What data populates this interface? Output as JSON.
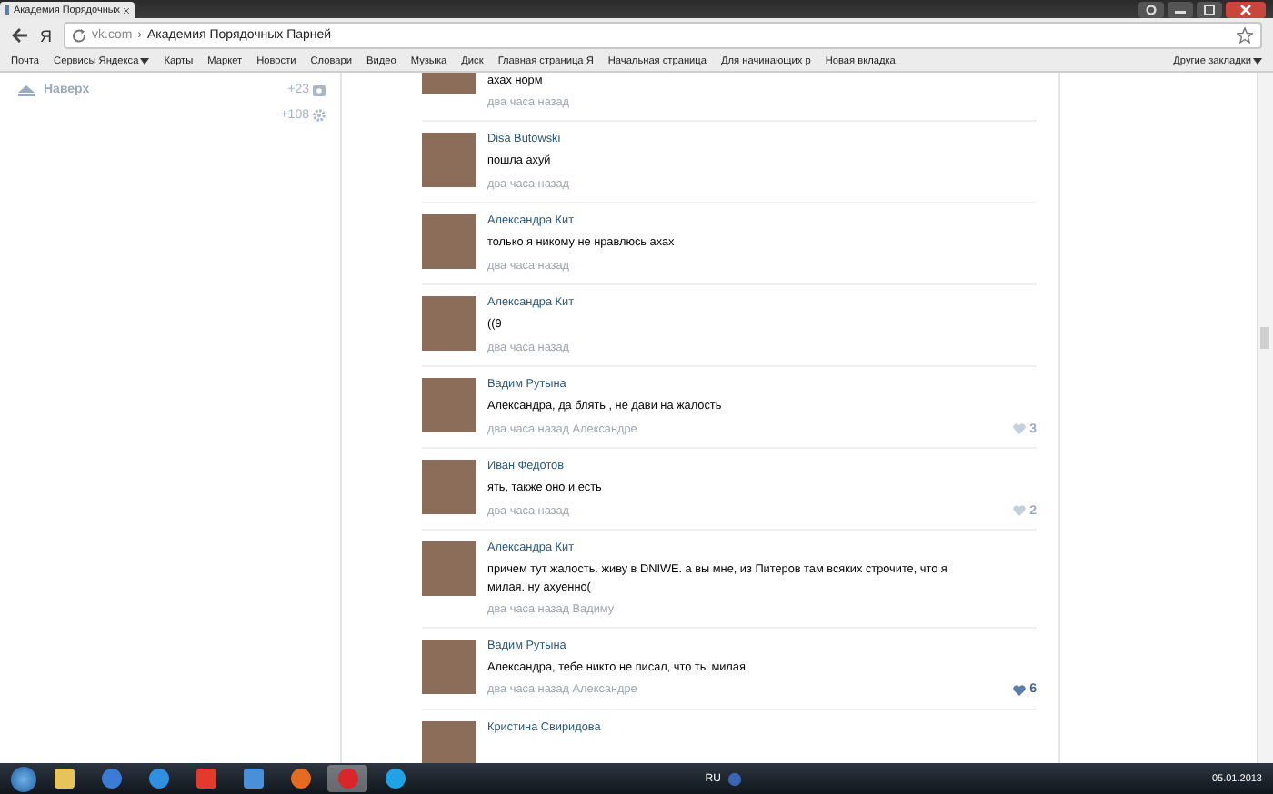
{
  "browser": {
    "tab": {
      "title": "Академия Порядочных"
    },
    "address": {
      "logo": "Я",
      "domain": "vk.com",
      "separator": "›",
      "title": "Академия Порядочных Парней"
    },
    "bookmarks": [
      {
        "label": "Почта",
        "menu": false
      },
      {
        "label": "Сервисы Яндекса",
        "menu": true
      },
      {
        "label": "Карты",
        "menu": false
      },
      {
        "label": "Маркет",
        "menu": false
      },
      {
        "label": "Новости",
        "menu": false
      },
      {
        "label": "Словари",
        "menu": false
      },
      {
        "label": "Видео",
        "menu": false
      },
      {
        "label": "Музыка",
        "menu": false
      },
      {
        "label": "Диск",
        "menu": false
      },
      {
        "label": "Главная страница Я",
        "menu": false
      },
      {
        "label": "Начальная страница",
        "menu": false
      },
      {
        "label": "Для начинающих р",
        "menu": false
      },
      {
        "label": "Новая вкладка",
        "menu": false
      }
    ],
    "other_bookmarks": {
      "label": "Другие закладки",
      "menu": true
    }
  },
  "sidebar": {
    "up": "Наверх",
    "counters": [
      {
        "kind": "photos",
        "count": "+23"
      },
      {
        "kind": "settings",
        "count": "+108"
      }
    ]
  },
  "comments": [
    {
      "text": "ахах норм",
      "time": "два часа назад"
    },
    {
      "name": "Disa Butowski",
      "text": "пошла ахуй",
      "time": "два часа назад"
    },
    {
      "name": "Александра Кит",
      "text": "только я никому не нравлюсь ахах",
      "time": "два часа назад"
    },
    {
      "name": "Александра Кит",
      "text": "((9",
      "time": "два часа назад"
    },
    {
      "name": "Вадим Рутына",
      "text": "Александра, да блять , не дави на жалость",
      "time": "два часа назад",
      "reply_to": "Александре",
      "likes": {
        "count": "3",
        "liked": false
      }
    },
    {
      "name": "Иван Федотов",
      "text": "ять, также оно и есть",
      "time": "два часа назад",
      "likes": {
        "count": "2",
        "liked": false
      }
    },
    {
      "name": "Александра Кит",
      "text": "причем тут жалость. живу в DNIWE. а вы мне, из Питеров там всяких строчите, что я милая. ну ахуенно(",
      "time": "два часа назад",
      "reply_to": "Вадиму"
    },
    {
      "name": "Вадим Рутына",
      "text": "Александра, тебе никто не писал, что ты милая",
      "time": "два часа назад",
      "reply_to": "Александре",
      "likes": {
        "count": "6",
        "liked": true
      }
    },
    {
      "name": "Кристина Свиридова"
    }
  ],
  "taskbar": {
    "apps": [
      {
        "kind": "folder",
        "active": false
      },
      {
        "kind": "globe",
        "active": false
      },
      {
        "kind": "ie",
        "active": false
      },
      {
        "kind": "yandex",
        "active": false
      },
      {
        "kind": "mail",
        "active": false
      },
      {
        "kind": "firefox",
        "active": false
      },
      {
        "kind": "ybrowser",
        "active": true
      },
      {
        "kind": "skype",
        "active": false
      }
    ],
    "lang": "RU",
    "date": "05.01.2013"
  }
}
